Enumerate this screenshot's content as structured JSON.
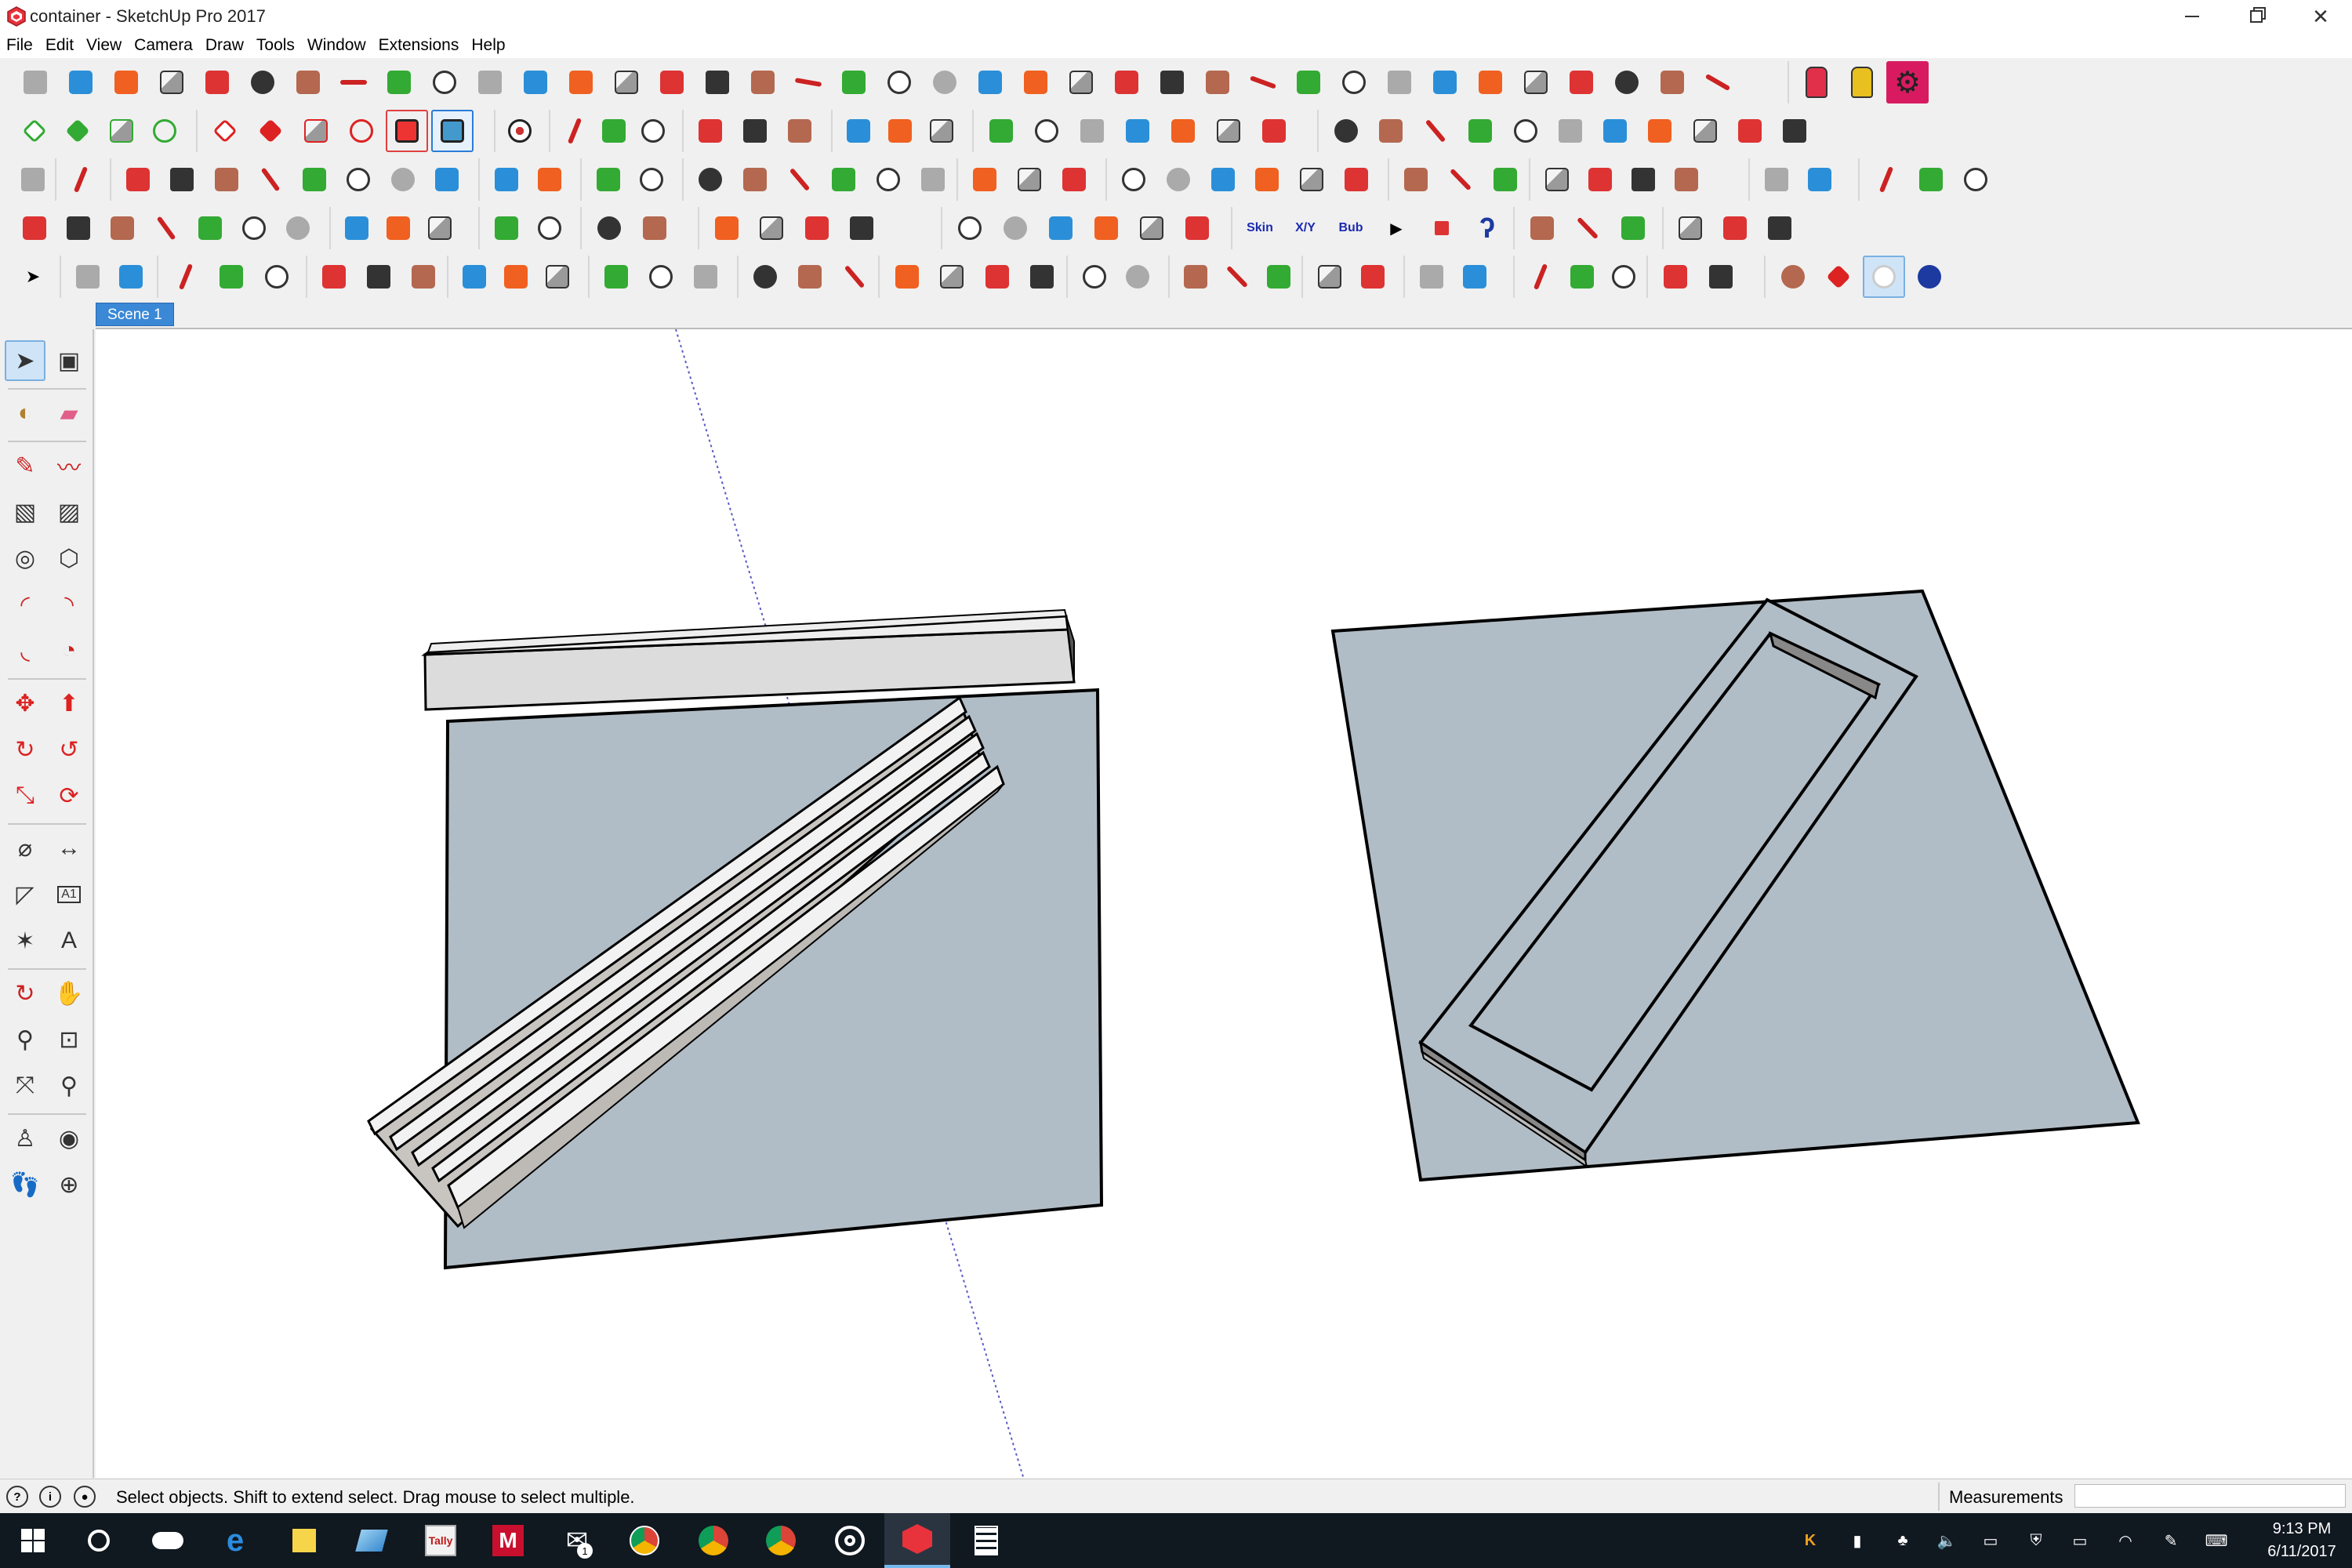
{
  "window": {
    "title": "container - SketchUp Pro 2017",
    "icon": "sketchup-logo-icon",
    "controls": [
      "minimize-icon",
      "restore-icon",
      "close-icon"
    ]
  },
  "menubar": {
    "items": [
      {
        "label": "File"
      },
      {
        "label": "Edit"
      },
      {
        "label": "View"
      },
      {
        "label": "Camera"
      },
      {
        "label": "Draw"
      },
      {
        "label": "Tools"
      },
      {
        "label": "Window"
      },
      {
        "label": "Extensions"
      },
      {
        "label": "Help"
      }
    ]
  },
  "toolbars": {
    "row1_count": 49,
    "row2_count": 38,
    "row3_count": 45,
    "row4_count": 40,
    "row5_count": 41,
    "row4_text_buttons": [
      "Skin",
      "X/Y",
      "Bub"
    ]
  },
  "scenes": {
    "active_tab": "Scene 1"
  },
  "left_toolbar": {
    "tools": [
      [
        "select-icon",
        "make-component-icon"
      ],
      [
        "paint-bucket-icon",
        "eraser-icon"
      ],
      [
        "pencil-icon",
        "freehand-icon"
      ],
      [
        "rectangle-icon",
        "rotated-rectangle-icon"
      ],
      [
        "circle-icon",
        "polygon-icon"
      ],
      [
        "arc-icon",
        "two-point-arc-icon"
      ],
      [
        "three-point-arc-icon",
        "pie-icon"
      ],
      [
        "move-icon",
        "push-pull-icon"
      ],
      [
        "rotate-icon",
        "follow-me-icon"
      ],
      [
        "scale-icon",
        "offset-icon"
      ],
      [
        "tape-measure-icon",
        "dimension-icon"
      ],
      [
        "protractor-icon",
        "text-icon"
      ],
      [
        "axes-icon",
        "3d-text-icon"
      ],
      [
        "orbit-icon",
        "pan-icon"
      ],
      [
        "zoom-icon",
        "zoom-window-icon"
      ],
      [
        "zoom-extents-icon",
        "previous-view-icon"
      ],
      [
        "position-camera-icon",
        "look-around-icon"
      ],
      [
        "walk-icon",
        "section-plane-icon"
      ]
    ],
    "text_tool_label": "A1"
  },
  "statusbar": {
    "message": "Select objects. Shift to extend select. Drag mouse to select multiple.",
    "measurements_label": "Measurements",
    "measurements_value": ""
  },
  "taskbar": {
    "apps": [
      "start-icon",
      "cortana-icon",
      "onedrive-icon",
      "edge-icon",
      "sticky-notes-icon",
      "app-icon",
      "tally-icon",
      "mcafee-icon",
      "mail-icon",
      "chrome-icon",
      "chrome-profile-icon",
      "chrome-profile2-icon",
      "groove-icon",
      "sketchup-icon",
      "calculator-icon"
    ],
    "tally_label": "Tally",
    "mcafee_label": "M",
    "mail_badge": "1",
    "time": "9:13 PM",
    "date": "6/11/2017"
  },
  "colors": {
    "accent": "#3a88d6",
    "ground_face": "#b1bdc6",
    "component_face": "#d9d9d9",
    "taskbar": "#101820"
  }
}
